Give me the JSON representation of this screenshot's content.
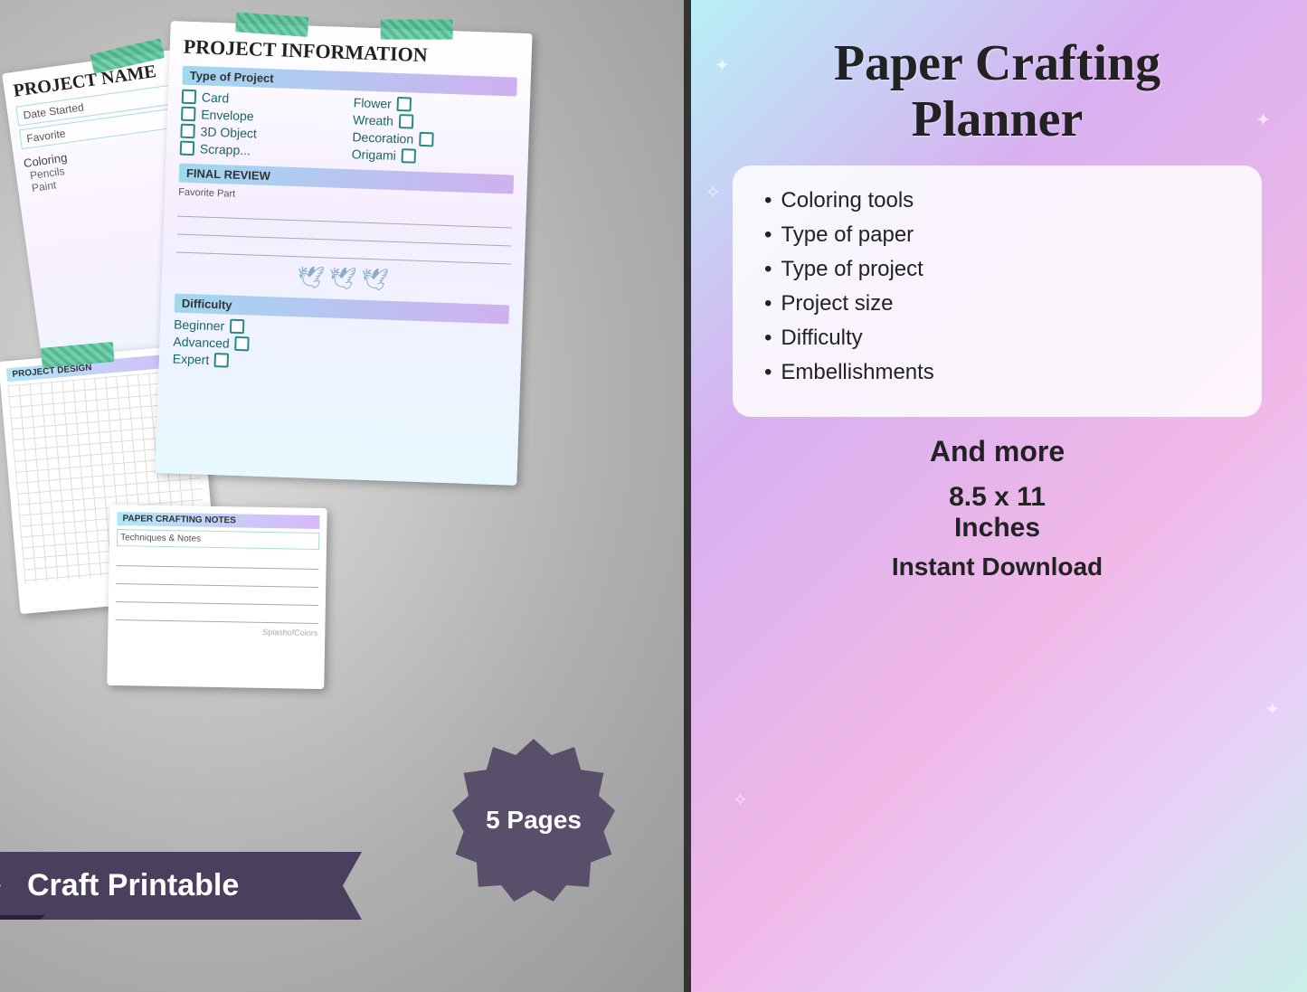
{
  "left": {
    "cards": {
      "project_name": {
        "title": "PROJECT NAME",
        "fields": [
          "Date Started",
          "Favorite",
          "Coloring",
          "Pencils",
          "Paint"
        ]
      },
      "project_info": {
        "title": "PROJECT INFORMATION",
        "section_type": "Type of Project",
        "items_left": [
          "Card",
          "Envelope",
          "3D Object",
          "Scrapp..."
        ],
        "items_right": [
          "Flower",
          "Wreath",
          "Decoration",
          "Origami"
        ],
        "section_final": "FINAL REVIEW",
        "final_label": "Favorite Part",
        "section_difficulty": "Difficulty",
        "difficulty_items": [
          "Beginner",
          "Advanced",
          "Expert"
        ]
      },
      "project_design": {
        "title": "PROJECT DESIGN"
      },
      "notes": {
        "title": "PAPER CRAFTING NOTES",
        "subtitle": "Techniques & Notes"
      }
    },
    "banner": {
      "line1": "Craft Printable"
    },
    "badge": {
      "text": "5 Pages"
    }
  },
  "right": {
    "title_line1": "Paper Crafting",
    "title_line2": "Planner",
    "features": [
      "Coloring tools",
      "Type of paper",
      "Type of project",
      "Project size",
      "Difficulty",
      "Embellishments"
    ],
    "and_more": "And more",
    "size": "8.5 x 11\nInches",
    "instant": "Instant Download"
  }
}
